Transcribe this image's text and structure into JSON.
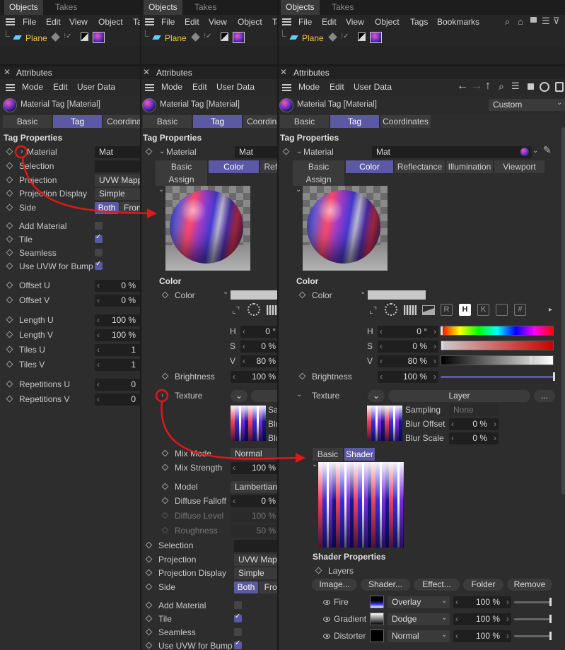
{
  "colors": {
    "accent": "#5b59a3",
    "highlight_text": "#f0c040",
    "arrow": "#e01818"
  },
  "panels": [
    {
      "objects_tab": "Objects",
      "takes_tab": "Takes",
      "menu": [
        "File",
        "Edit",
        "View",
        "Object",
        "Ta"
      ],
      "object_name": "Plane",
      "attributes_title": "Attributes",
      "attr_menu": [
        "Mode",
        "Edit",
        "User Data"
      ],
      "tag_title": "Material Tag [Material]",
      "tabs": [
        "Basic",
        "Tag",
        "Coordina"
      ],
      "section": "Tag Properties",
      "material_label": "Material",
      "material_value": "Mat",
      "selection_label": "Selection",
      "projection_label": "Projection",
      "projection_value": "UVW Mapp",
      "projdisp_label": "Projection Display",
      "projdisp_value": "Simple",
      "side_label": "Side",
      "side_both": "Both",
      "side_front": "Front",
      "add_material": "Add Material",
      "tile": "Tile",
      "seamless": "Seamless",
      "use_uvw": "Use UVW for Bump",
      "offset_u": "Offset U",
      "offset_u_val": "0 %",
      "offset_v": "Offset V",
      "offset_v_val": "0 %",
      "length_u": "Length U",
      "length_u_val": "100 %",
      "length_v": "Length V",
      "length_v_val": "100 %",
      "tiles_u": "Tiles U",
      "tiles_u_val": "1",
      "tiles_v": "Tiles V",
      "tiles_v_val": "1",
      "rep_u": "Repetitions U",
      "rep_u_val": "0",
      "rep_v": "Repetitions V",
      "rep_v_val": "0"
    },
    {
      "objects_tab": "Objects",
      "takes_tab": "Takes",
      "menu": [
        "File",
        "Edit",
        "View",
        "Object",
        "Ta"
      ],
      "object_name": "Plane",
      "attributes_title": "Attributes",
      "attr_menu": [
        "Mode",
        "Edit",
        "User Data"
      ],
      "tag_title": "Material Tag [Material]",
      "tabs": [
        "Basic",
        "Tag",
        "Coordina"
      ],
      "section": "Tag Properties",
      "material_label": "Material",
      "material_value": "Mat",
      "mat_tabs": [
        "Basic",
        "Color",
        "Refle"
      ],
      "assign": "Assign",
      "color_section": "Color",
      "color_label": "Color",
      "h": "H",
      "h_val": "0 °",
      "s": "S",
      "s_val": "0 %",
      "v": "V",
      "v_val": "80 %",
      "brightness": "Brightness",
      "brightness_val": "100 %",
      "texture": "Texture",
      "tex_side": [
        "Sa",
        "Blu",
        "Blu"
      ],
      "mix_mode": "Mix Mode",
      "mix_mode_val": "Normal",
      "mix_strength": "Mix Strength",
      "mix_strength_val": "100 %",
      "model": "Model",
      "model_val": "Lambertian",
      "diffuse_falloff": "Diffuse Falloff",
      "diffuse_falloff_val": "0 %",
      "diffuse_level": "Diffuse Level",
      "diffuse_level_val": "100 %",
      "roughness": "Roughness",
      "roughness_val": "50 %",
      "selection": "Selection",
      "projection": "Projection",
      "projection_val": "UVW Mapp",
      "projdisp": "Projection Display",
      "projdisp_val": "Simple",
      "side": "Side",
      "side_both": "Both",
      "side_front": "Fron",
      "add_material": "Add Material",
      "tile": "Tile",
      "seamless": "Seamless",
      "use_uvw": "Use UVW for Bump"
    },
    {
      "objects_tab": "Objects",
      "takes_tab": "Takes",
      "menu": [
        "File",
        "Edit",
        "View",
        "Object",
        "Tags",
        "Bookmarks"
      ],
      "object_name": "Plane",
      "attributes_title": "Attributes",
      "attr_menu": [
        "Mode",
        "Edit",
        "User Data"
      ],
      "layout_value": "Custom",
      "tag_title": "Material Tag [Material]",
      "tabs": [
        "Basic",
        "Tag",
        "Coordinates"
      ],
      "section": "Tag Properties",
      "material_label": "Material",
      "material_value": "Mat",
      "mat_tabs": [
        "Basic",
        "Color",
        "Reflectance",
        "Illumination",
        "Viewport"
      ],
      "assign": "Assign",
      "color_section": "Color",
      "color_label": "Color",
      "icon_letters": [
        "R",
        "H",
        "K",
        "#"
      ],
      "h": "H",
      "h_val": "0 °",
      "s": "S",
      "s_val": "0 %",
      "v": "V",
      "v_val": "80 %",
      "brightness": "Brightness",
      "brightness_val": "100 %",
      "brightness_level": 1.0,
      "texture": "Texture",
      "layer_btn": "Layer",
      "more_btn": "...",
      "sampling": "Sampling",
      "sampling_val": "None",
      "blur_offset": "Blur Offset",
      "blur_offset_val": "0 %",
      "blur_scale": "Blur Scale",
      "blur_scale_val": "0 %",
      "shader_tabs": [
        "Basic",
        "Shader"
      ],
      "shader_props": "Shader Properties",
      "layers": "Layers",
      "layer_buttons": [
        "Image...",
        "Shader...",
        "Effect...",
        "Folder",
        "Remove"
      ],
      "layer_rows": [
        {
          "name": "Fire",
          "mode": "Overlay",
          "value": "100 %",
          "level": 1.0
        },
        {
          "name": "Gradient",
          "mode": "Dodge",
          "value": "100 %",
          "level": 1.0
        },
        {
          "name": "Distorter",
          "mode": "Normal",
          "value": "100 %",
          "level": 1.0
        }
      ]
    }
  ]
}
